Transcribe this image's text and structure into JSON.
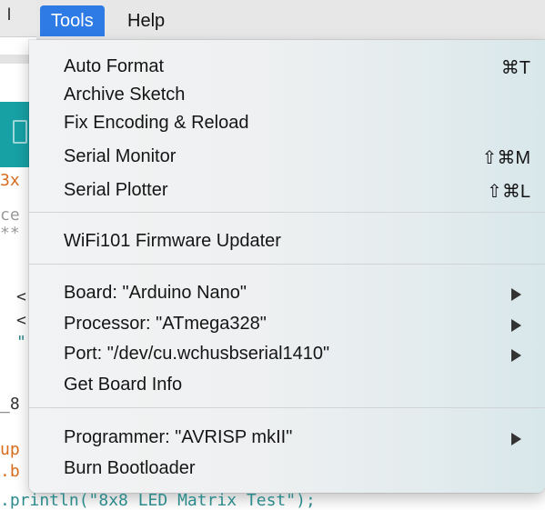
{
  "menubar": {
    "items": [
      {
        "label": "Tools",
        "active": true
      },
      {
        "label": "Help",
        "active": false
      }
    ]
  },
  "background": {
    "app_menu_fragment": "l",
    "code_fragments": [
      "3x",
      "ce",
      "**",
      "<",
      "<",
      "\"",
      "_8",
      "up",
      ".b"
    ],
    "bottom_line": ".println(\"8x8 LED Matrix Test\");"
  },
  "menu": {
    "items": [
      {
        "label": "Auto Format",
        "shortcut": "⌘T"
      },
      {
        "label": "Archive Sketch",
        "shortcut": ""
      },
      {
        "label": "Fix Encoding & Reload",
        "shortcut": ""
      },
      {
        "label": "Serial Monitor",
        "shortcut": "⇧⌘M"
      },
      {
        "label": "Serial Plotter",
        "shortcut": "⇧⌘L"
      },
      {
        "label": "WiFi101 Firmware Updater",
        "shortcut": ""
      },
      {
        "label": "Board: \"Arduino Nano\"",
        "submenu": true
      },
      {
        "label": "Processor: \"ATmega328\"",
        "submenu": true
      },
      {
        "label": "Port: \"/dev/cu.wchusbserial1410\"",
        "submenu": true
      },
      {
        "label": "Get Board Info",
        "submenu": false
      },
      {
        "label": "Programmer: \"AVRISP mkII\"",
        "submenu": true
      },
      {
        "label": "Burn Bootloader",
        "submenu": false
      }
    ]
  }
}
